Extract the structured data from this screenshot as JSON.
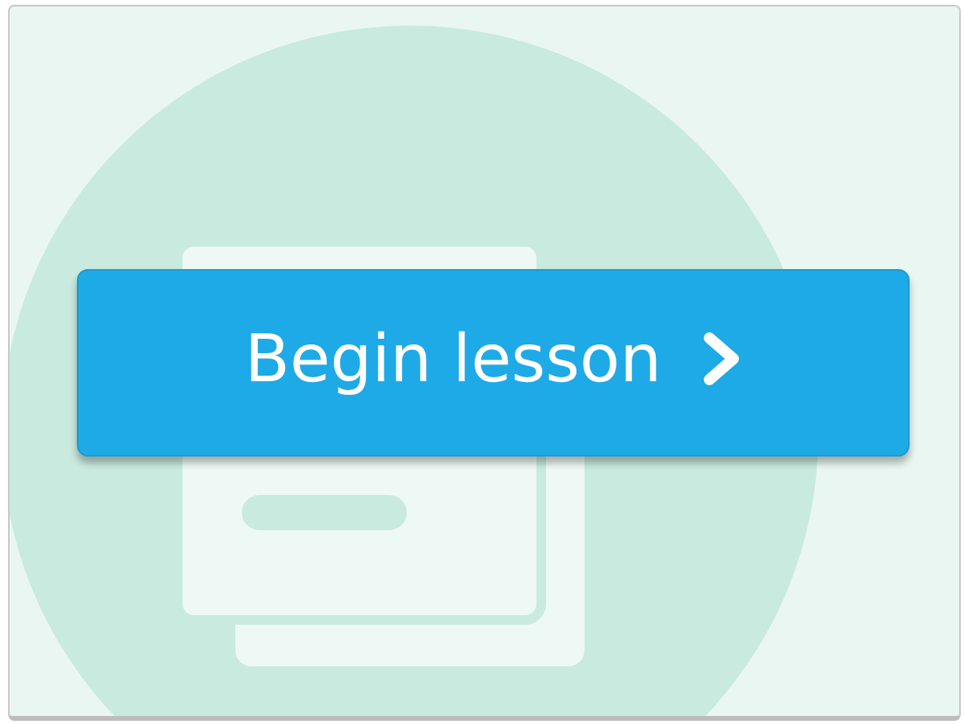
{
  "button": {
    "label": "Begin lesson"
  }
}
